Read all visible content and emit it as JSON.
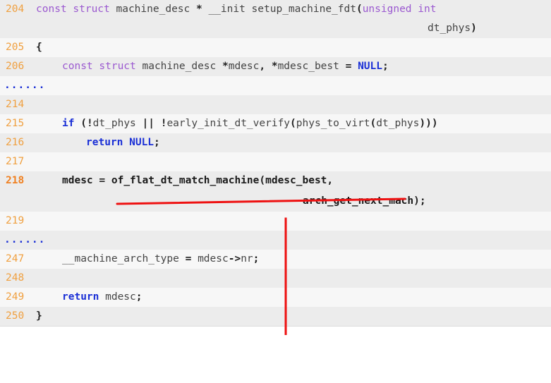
{
  "code": {
    "l204_num": "204",
    "l204_a": "const struct",
    "l204_b": " machine_desc ",
    "l204_c": "*",
    "l204_d": " __init setup_machine_fdt",
    "l204_e": "(",
    "l204_f": "unsigned int",
    "l204_cont": "dt_phys",
    "l204_close": ")",
    "l205_num": "205",
    "l205_brace": "{",
    "l206_num": "206",
    "l206_a": "const struct",
    "l206_b": " machine_desc ",
    "l206_c": "*",
    "l206_d": "mdesc",
    "l206_e": ", ",
    "l206_f": "*",
    "l206_g": "mdesc_best ",
    "l206_h": "= ",
    "l206_i": "NULL",
    "l206_j": ";",
    "ellipsis1": "......",
    "l214_num": "214",
    "l215_num": "215",
    "l215_if": "if",
    "l215_a": " (",
    "l215_b": "!",
    "l215_c": "dt_phys ",
    "l215_d": "|| !",
    "l215_e": "early_init_dt_verify",
    "l215_f": "(",
    "l215_g": "phys_to_virt",
    "l215_h": "(",
    "l215_i": "dt_phys",
    "l215_j": ")))",
    "l216_num": "216",
    "l216_ret": "return",
    "l216_null": " NULL",
    "l216_semi": ";",
    "l217_num": "217",
    "l218_num": "218",
    "l218_a": "mdesc ",
    "l218_b": "= ",
    "l218_c": "of_flat_dt_match_machine",
    "l218_d": "(",
    "l218_e": "mdesc_best,",
    "l218_cont": "arch_get_next_mach",
    "l218_close": ");",
    "l219_num": "219",
    "ellipsis2": "......",
    "l247_num": "247",
    "l247_a": "__machine_arch_type ",
    "l247_b": "= ",
    "l247_c": "mdesc",
    "l247_d": "->",
    "l247_e": "nr",
    "l247_f": ";",
    "l248_num": "248",
    "l249_num": "249",
    "l249_ret": "return",
    "l249_a": " mdesc",
    "l249_b": ";",
    "l250_num": "250",
    "l250_brace": "}"
  },
  "annotation": {
    "color": "#ee1111"
  }
}
